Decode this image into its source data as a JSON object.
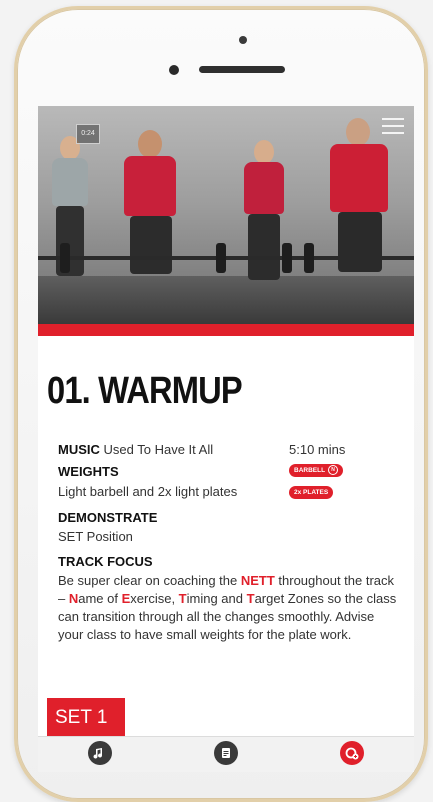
{
  "video": {
    "time": "0:24"
  },
  "track": {
    "title": "01. WARMUP",
    "music_label": "MUSIC",
    "music_value": "Used To Have It All",
    "duration": "5:10 mins",
    "weights_label": "WEIGHTS",
    "weights_value": "Light barbell and 2x light plates",
    "badges": [
      "BARBELL",
      "2x PLATES"
    ],
    "demonstrate_label": "DEMONSTRATE",
    "demonstrate_value": "SET Position",
    "focus_label": "TRACK FOCUS",
    "focus_p1": "Be super clear on coaching the ",
    "focus_nett": "NETT",
    "focus_p2": " throughout the track – ",
    "focus_n": "N",
    "focus_p3": "ame of ",
    "focus_e": "E",
    "focus_p4": "xercise, ",
    "focus_t1": "T",
    "focus_p5": "iming and ",
    "focus_t2": "T",
    "focus_p6": "arget Zones so the class can transition through all the changes smoothly. Advise your class to have small weights for the plate work."
  },
  "set_tab": {
    "label": "SET 1"
  },
  "nav": {
    "items": [
      {
        "icon": "music-note-icon"
      },
      {
        "icon": "document-icon"
      },
      {
        "icon": "plate-add-icon"
      }
    ]
  },
  "colors": {
    "accent": "#e0202b"
  }
}
